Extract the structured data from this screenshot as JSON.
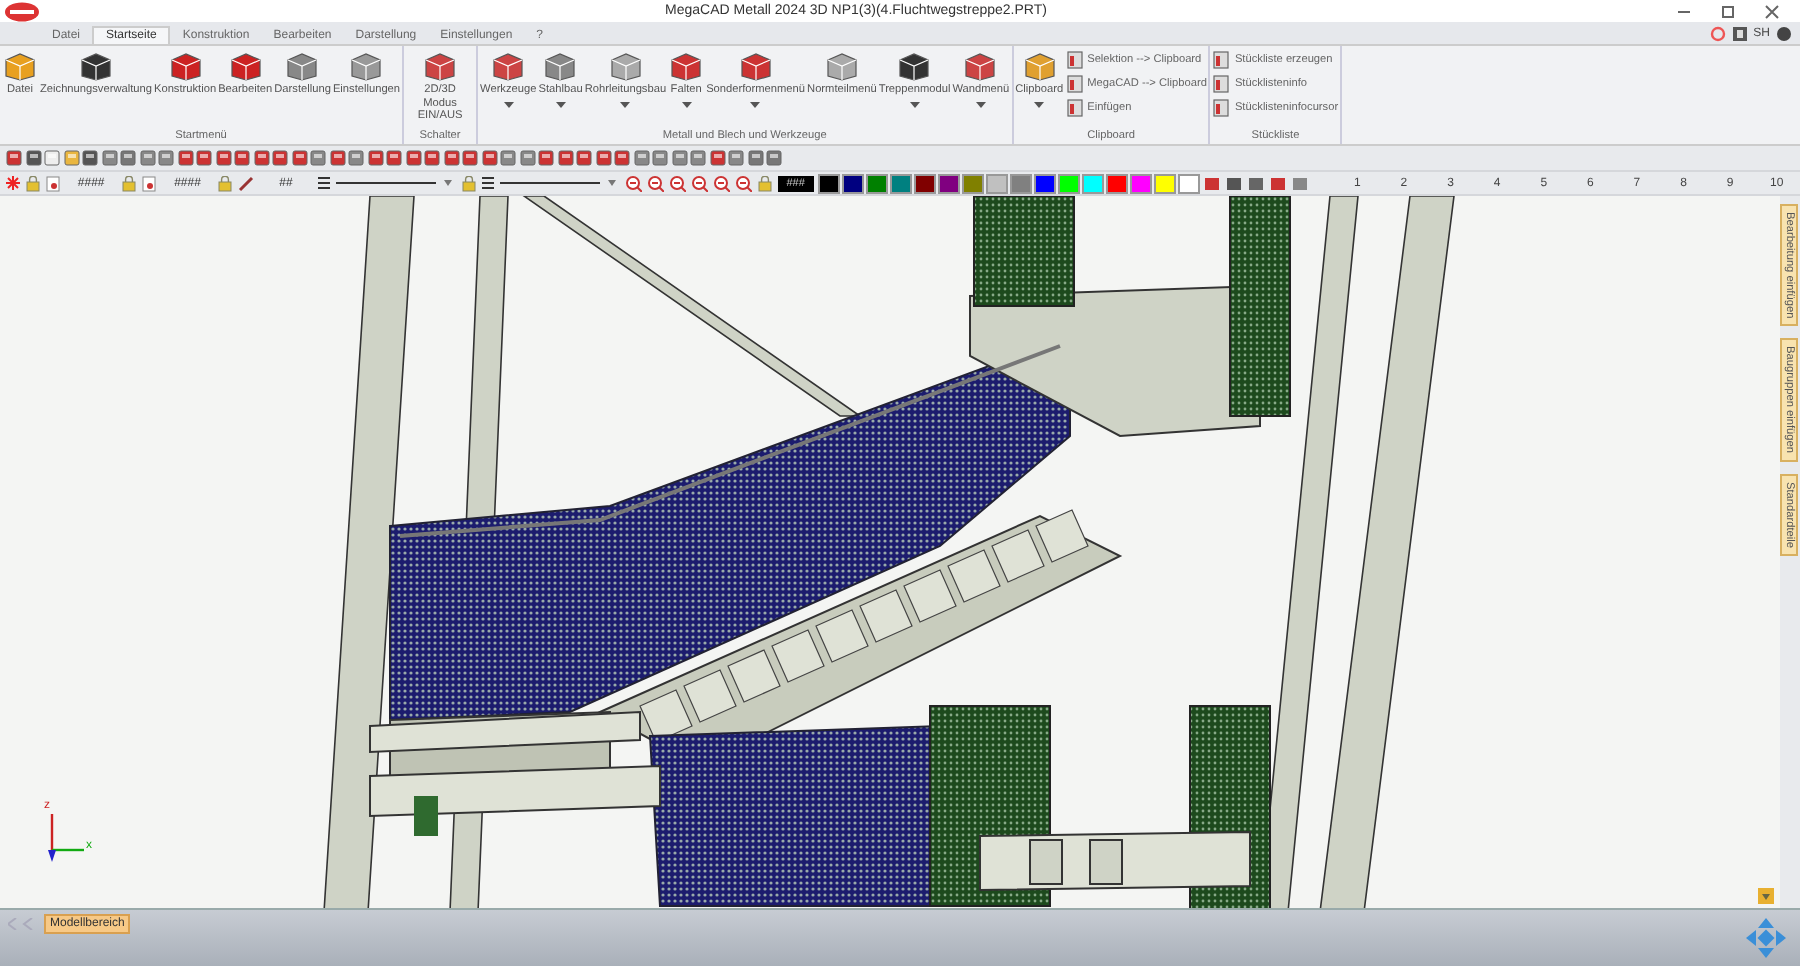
{
  "window": {
    "title": "MegaCAD Metall 2024 3D NP1(3)(4.Fluchtwegstreppe2.PRT)",
    "user": "SH"
  },
  "tabs": [
    {
      "label": "Datei",
      "selected": false
    },
    {
      "label": "Startseite",
      "selected": true
    },
    {
      "label": "Konstruktion",
      "selected": false
    },
    {
      "label": "Bearbeiten",
      "selected": false
    },
    {
      "label": "Darstellung",
      "selected": false
    },
    {
      "label": "Einstellungen",
      "selected": false
    },
    {
      "label": "?",
      "selected": false
    }
  ],
  "ribbon_groups": [
    {
      "title": "Startmenü",
      "buttons": [
        {
          "label": "Datei",
          "dropdown": false
        },
        {
          "label": "Zeichnungsverwaltung",
          "dropdown": false
        },
        {
          "label": "Konstruktion",
          "dropdown": false
        },
        {
          "label": "Bearbeiten",
          "dropdown": false
        },
        {
          "label": "Darstellung",
          "dropdown": false
        },
        {
          "label": "Einstellungen",
          "dropdown": false
        }
      ]
    },
    {
      "title": "Schalter",
      "buttons": [
        {
          "label": "2D/3D Modus EIN/AUS",
          "dropdown": false
        }
      ]
    },
    {
      "title": "Metall und Blech und Werkzeuge",
      "buttons": [
        {
          "label": "Werkzeuge",
          "dropdown": true
        },
        {
          "label": "Stahlbau",
          "dropdown": true
        },
        {
          "label": "Rohrleitungsbau",
          "dropdown": true
        },
        {
          "label": "Falten",
          "dropdown": true
        },
        {
          "label": "Sonderformenmenü",
          "dropdown": true
        },
        {
          "label": "Normteilmenü",
          "dropdown": false
        },
        {
          "label": "Treppenmodul",
          "dropdown": true
        },
        {
          "label": "Wandmenü",
          "dropdown": true
        }
      ]
    },
    {
      "title": "Clipboard",
      "buttons": [
        {
          "label": "Clipboard",
          "dropdown": true
        }
      ],
      "small_buttons": [
        "Selektion --> Clipboard",
        "MegaCAD --> Clipboard",
        "Einfügen"
      ]
    },
    {
      "title": "Stückliste",
      "small_buttons": [
        "Stückliste erzeugen",
        "Stücklisteninfo",
        "Stücklisteninfocursor"
      ]
    }
  ],
  "toolbar": {
    "fields": [
      "####",
      "####",
      "##"
    ],
    "color_code": "###",
    "palette": [
      {
        "color": "#000000"
      },
      {
        "color": "#000080"
      },
      {
        "color": "#008000"
      },
      {
        "color": "#008080"
      },
      {
        "color": "#800000"
      },
      {
        "color": "#800080"
      },
      {
        "color": "#808000"
      },
      {
        "color": "#c0c0c0"
      },
      {
        "color": "#808080"
      },
      {
        "color": "#0000ff"
      },
      {
        "color": "#00ff00"
      },
      {
        "color": "#00ffff"
      },
      {
        "color": "#ff0000"
      },
      {
        "color": "#ff00ff"
      },
      {
        "color": "#ffff00"
      },
      {
        "color": "#ffffff"
      }
    ],
    "layers": [
      "1",
      "2",
      "3",
      "4",
      "5",
      "6",
      "7",
      "8",
      "9",
      "10"
    ]
  },
  "side_tabs": [
    "Bearbeitung einfügen",
    "Baugruppen einfügen",
    "Standardteile"
  ],
  "viewport": {
    "axis_z": "z",
    "axis_x": "x"
  },
  "bottom_tabs": [
    {
      "label": "Modellbereich",
      "selected": true
    }
  ]
}
